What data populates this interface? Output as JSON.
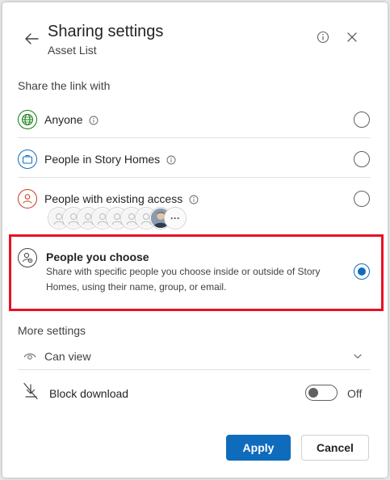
{
  "header": {
    "title": "Sharing settings",
    "subtitle": "Asset List"
  },
  "share_section_label": "Share the link with",
  "options": [
    {
      "label": "Anyone",
      "icon": "globe-icon",
      "selected": false,
      "color": "#107c10"
    },
    {
      "label": "People in Story Homes",
      "icon": "briefcase-icon",
      "selected": false,
      "color": "#0f6cbd"
    },
    {
      "label": "People with existing access",
      "icon": "person-icon",
      "selected": false,
      "color": "#c43e1c"
    },
    {
      "label": "People you choose",
      "icon": "people-settings-icon",
      "selected": true,
      "color": "#424242",
      "description": "Share with specific people you choose inside or outside of Story Homes, using their name, group, or email."
    }
  ],
  "existing_access_avatars": {
    "count_shown": 8,
    "more_label": "···"
  },
  "more_settings": {
    "label": "More settings",
    "permission": "Can view",
    "block_download_label": "Block download",
    "block_download_state": "Off"
  },
  "buttons": {
    "apply": "Apply",
    "cancel": "Cancel"
  },
  "colors": {
    "accent": "#0f6cbd",
    "highlight": "#e81123"
  }
}
